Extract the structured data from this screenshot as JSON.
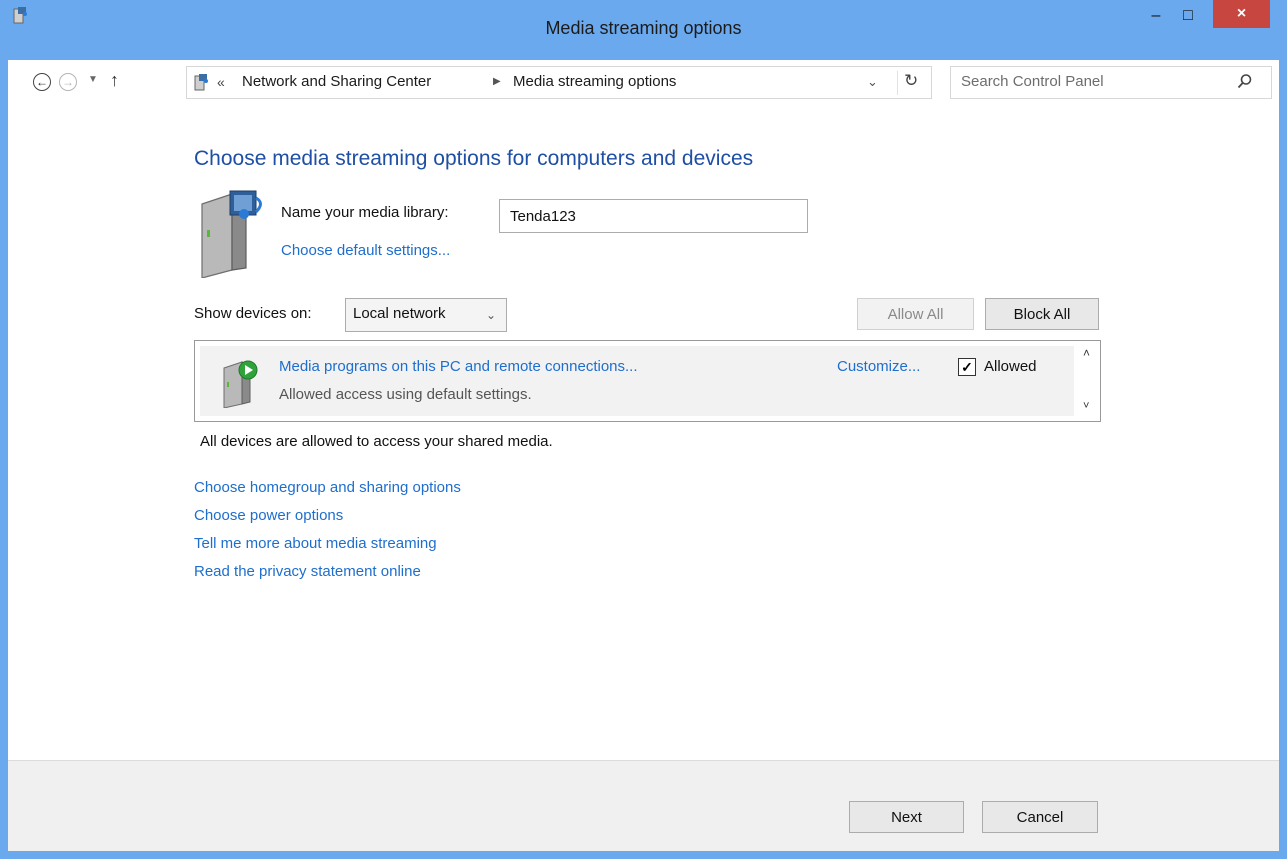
{
  "window": {
    "title": "Media streaming options"
  },
  "title_controls": {
    "minimize": "–",
    "maximize": "□",
    "close": "×"
  },
  "nav": {
    "back_glyph": "←",
    "forward_glyph": "→",
    "recent_glyph": "▼",
    "up_glyph": "↑",
    "separator": "«",
    "crumb_arrow": "▶",
    "breadcrumbs": [
      "Network and Sharing Center",
      "Media streaming options"
    ],
    "dropdown_glyph": "⌄",
    "refresh_glyph": "↻",
    "search_placeholder": "Search Control Panel"
  },
  "main": {
    "heading": "Choose media streaming options for computers and devices",
    "library": {
      "label": "Name your media library:",
      "value": "Tenda123",
      "defaults_link": "Choose default settings..."
    },
    "show_devices": {
      "label": "Show devices on:",
      "selected": "Local network",
      "arrow": "⌄"
    },
    "buttons": {
      "allow_all": "Allow All",
      "block_all": "Block All"
    },
    "devices": [
      {
        "name": "Media programs on this PC and remote connections...",
        "status": "Allowed access using default settings.",
        "customize": "Customize...",
        "checked": "✓",
        "allowed_label": "Allowed"
      }
    ],
    "scroll": {
      "up": "˄",
      "down": "˅"
    },
    "note": "All devices are allowed to access your shared media.",
    "links": [
      "Choose homegroup and sharing options",
      "Choose power options",
      "Tell me more about media streaming",
      "Read the privacy statement online"
    ]
  },
  "footer": {
    "next": "Next",
    "cancel": "Cancel"
  },
  "colors": {
    "frame": "#6aa9ee",
    "link": "#1e6ecd",
    "heading": "#1e4fa5",
    "close": "#c7463f"
  }
}
